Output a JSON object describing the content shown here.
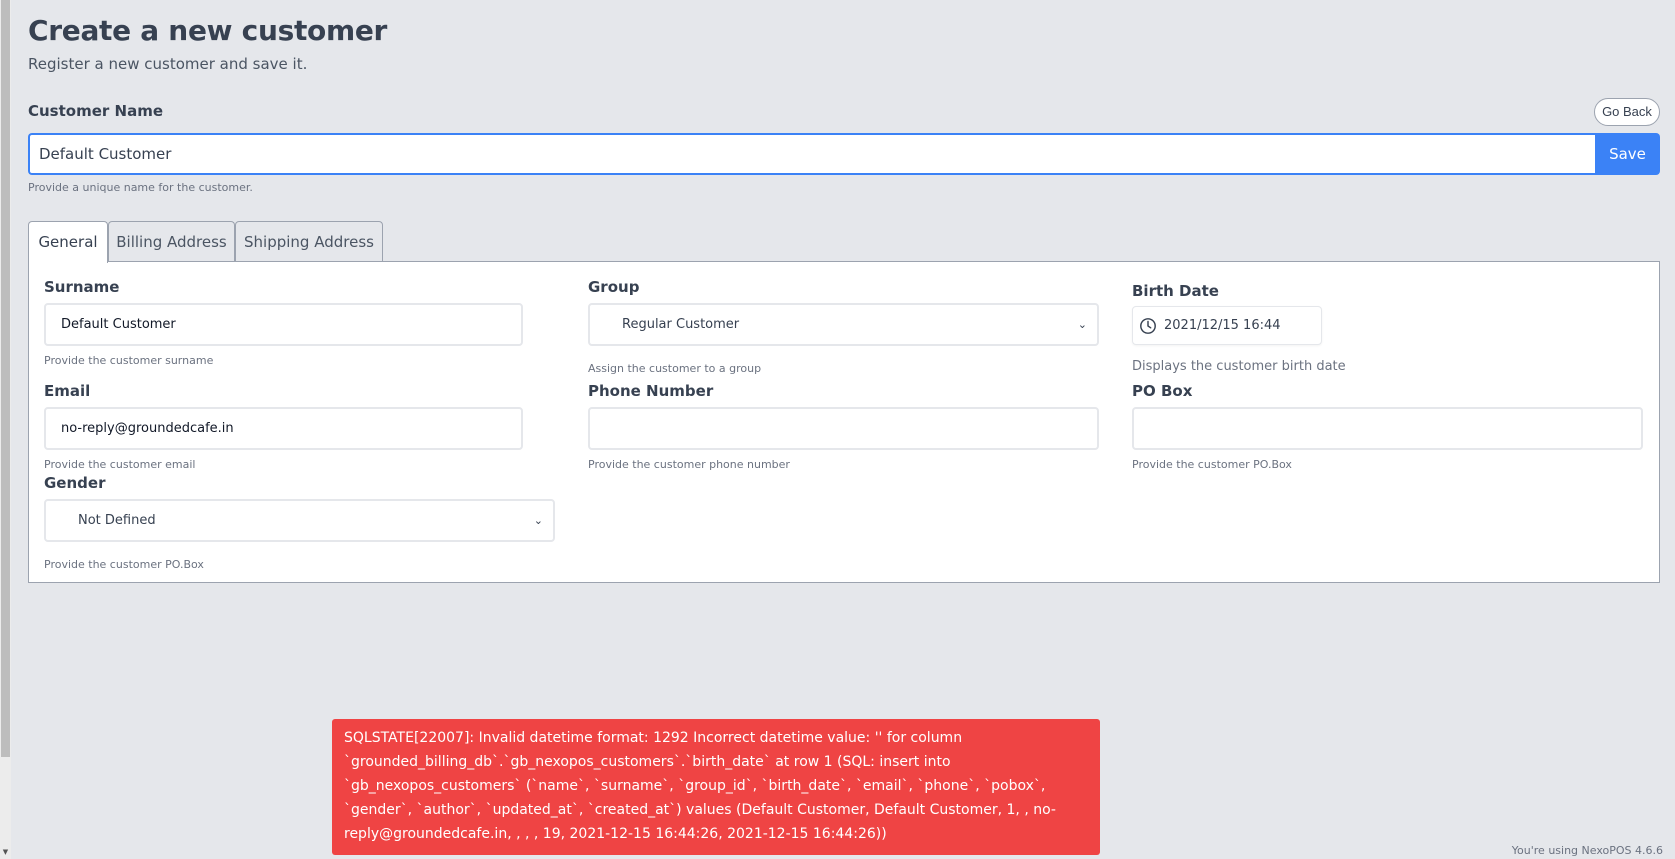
{
  "page": {
    "title": "Create a new customer",
    "subtitle": "Register a new customer and save it."
  },
  "customer_name": {
    "label": "Customer Name",
    "value": "Default Customer",
    "help": "Provide a unique name for the customer.",
    "save_label": "Save",
    "go_back_label": "Go Back"
  },
  "tabs": [
    {
      "label": "General",
      "active": true
    },
    {
      "label": "Billing Address",
      "active": false
    },
    {
      "label": "Shipping Address",
      "active": false
    }
  ],
  "fields": {
    "surname": {
      "label": "Surname",
      "value": "Default Customer",
      "help": "Provide the customer surname"
    },
    "group": {
      "label": "Group",
      "value": "Regular Customer",
      "help": "Assign the customer to a group"
    },
    "birth_date": {
      "label": "Birth Date",
      "value": "2021/12/15 16:44",
      "help": "Displays the customer birth date"
    },
    "email": {
      "label": "Email",
      "value": "no-reply@groundedcafe.in",
      "help": "Provide the customer email"
    },
    "phone": {
      "label": "Phone Number",
      "value": "",
      "help": "Provide the customer phone number"
    },
    "pobox": {
      "label": "PO Box",
      "value": "",
      "help": "Provide the customer PO.Box"
    },
    "gender": {
      "label": "Gender",
      "value": "Not Defined",
      "help": "Provide the customer PO.Box"
    }
  },
  "error": {
    "message": "SQLSTATE[22007]: Invalid datetime format: 1292 Incorrect datetime value: '' for column `grounded_billing_db`.`gb_nexopos_customers`.`birth_date` at row 1 (SQL: insert into `gb_nexopos_customers` (`name`, `surname`, `group_id`, `birth_date`, `email`, `phone`, `pobox`, `gender`, `author`, `updated_at`, `created_at`) values (Default Customer, Default Customer, 1, , no-reply@groundedcafe.in, , , , 19, 2021-12-15 16:44:26, 2021-12-15 16:44:26))"
  },
  "footer": {
    "version": "You're using NexoPOS 4.6.6"
  },
  "colors": {
    "primary": "#3b82f6",
    "error": "#ef4444",
    "background": "#e5e7eb"
  }
}
